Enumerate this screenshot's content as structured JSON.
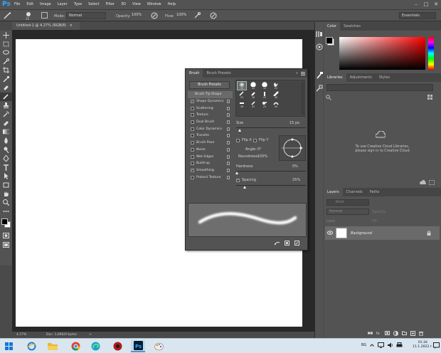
{
  "app": {
    "logo": "Ps",
    "menu": [
      "File",
      "Edit",
      "Image",
      "Layer",
      "Type",
      "Select",
      "Filter",
      "3D",
      "View",
      "Window",
      "Help"
    ],
    "window_controls": [
      "–",
      "□",
      "✕"
    ]
  },
  "options": {
    "size_value": "15",
    "mode_label": "Mode:",
    "mode_value": "Normal",
    "opacity_label": "Opacity:",
    "opacity_value": "100%",
    "flow_label": "Flow:",
    "flow_value": "100%",
    "workspace": "Essentials"
  },
  "document": {
    "tab_title": "Untitled-1 @ 4.27% (RGB/8)",
    "tab_close": "×",
    "zoom": "4.27%",
    "doc_info": "Doc: 1,06K/0 bytes",
    "arrow": ">"
  },
  "color_panel": {
    "tabs": [
      "Color",
      "Swatches"
    ],
    "hue_hex": "#ff0000"
  },
  "libraries_panel": {
    "tabs": [
      "Libraries",
      "Adjustments",
      "Styles"
    ],
    "message_line1": "To use Creative Cloud Libraries,",
    "message_line2": "please sign in to Creative Cloud"
  },
  "layers_panel": {
    "tabs": [
      "Layers",
      "Channels",
      "Paths"
    ],
    "kind_label": "Kind",
    "blend_mode": "Normal",
    "opacity_label": "Opacity:",
    "fill_label": "Fill:",
    "lock_label": "Lock:",
    "layer_name": "Background"
  },
  "brush_panel": {
    "tabs": [
      "Brush",
      "Brush Presets"
    ],
    "presets_button": "Brush Presets",
    "options": [
      {
        "label": "Brush Tip Shape",
        "checked": null,
        "active": true
      },
      {
        "label": "Shape Dynamics",
        "checked": true
      },
      {
        "label": "Scattering",
        "checked": false
      },
      {
        "label": "Texture",
        "checked": false
      },
      {
        "label": "Dual Brush",
        "checked": false
      },
      {
        "label": "Color Dynamics",
        "checked": false
      },
      {
        "label": "Transfer",
        "checked": false
      },
      {
        "label": "Brush Pose",
        "checked": false
      },
      {
        "label": "Noise",
        "checked": false
      },
      {
        "label": "Wet Edges",
        "checked": false
      },
      {
        "label": "Build-up",
        "checked": false
      },
      {
        "label": "Smoothing",
        "checked": true
      },
      {
        "label": "Protect Texture",
        "checked": false
      }
    ],
    "tip_sizes": [
      [
        "30",
        "30",
        "30",
        "25"
      ],
      [
        "25",
        "36",
        "25",
        "36"
      ],
      [
        "36",
        "32",
        "25",
        "50"
      ]
    ],
    "size_label": "Size",
    "size_value": "15 px",
    "flip_x": "Flip X",
    "flip_y": "Flip Y",
    "angle_label": "Angle:",
    "angle_value": "0°",
    "roundness_label": "Roundness:",
    "roundness_value": "100%",
    "hardness_label": "Hardness",
    "hardness_value": "0%",
    "spacing_label": "Spacing",
    "spacing_value": "25%",
    "collapse": "»"
  },
  "taskbar": {
    "lang": "BG",
    "time": "01:34",
    "date": "11.1.2022 г."
  }
}
